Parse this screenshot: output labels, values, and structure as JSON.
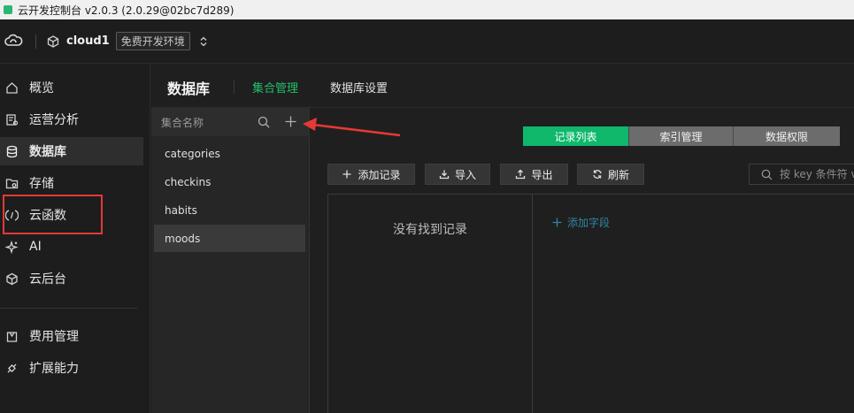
{
  "window": {
    "title": "云开发控制台 v2.0.3 (2.0.29@02bc7d289)"
  },
  "env": {
    "name": "cloud1",
    "tag": "免费开发环境"
  },
  "sidebar": {
    "items": [
      {
        "label": "概览",
        "icon": "home-icon"
      },
      {
        "label": "运营分析",
        "icon": "analytics-icon"
      },
      {
        "label": "数据库",
        "icon": "database-icon"
      },
      {
        "label": "存储",
        "icon": "storage-icon"
      },
      {
        "label": "云函数",
        "icon": "function-icon"
      },
      {
        "label": "AI",
        "icon": "sparkle-icon"
      },
      {
        "label": "云后台",
        "icon": "cube-icon"
      },
      {
        "label": "费用管理",
        "icon": "bag-icon"
      },
      {
        "label": "扩展能力",
        "icon": "plugin-icon"
      }
    ],
    "active": "数据库"
  },
  "header": {
    "title": "数据库",
    "tabs": [
      {
        "label": "集合管理",
        "active": true
      },
      {
        "label": "数据库设置",
        "active": false
      }
    ]
  },
  "collections": {
    "search_placeholder": "集合名称",
    "items": [
      "categories",
      "checkins",
      "habits",
      "moods"
    ],
    "selected": "moods"
  },
  "content": {
    "segments": [
      "记录列表",
      "索引管理",
      "数据权限"
    ],
    "active_segment": "记录列表",
    "toolbar": {
      "add": "添加记录",
      "import": "导入",
      "export": "导出",
      "refresh": "刷新"
    },
    "search_placeholder": "按 key 条件符 v",
    "empty_text": "没有找到记录",
    "add_field": "添加字段"
  },
  "colors": {
    "accent": "#0fb86b",
    "annotation": "#e53935",
    "link": "#2f86a6"
  }
}
